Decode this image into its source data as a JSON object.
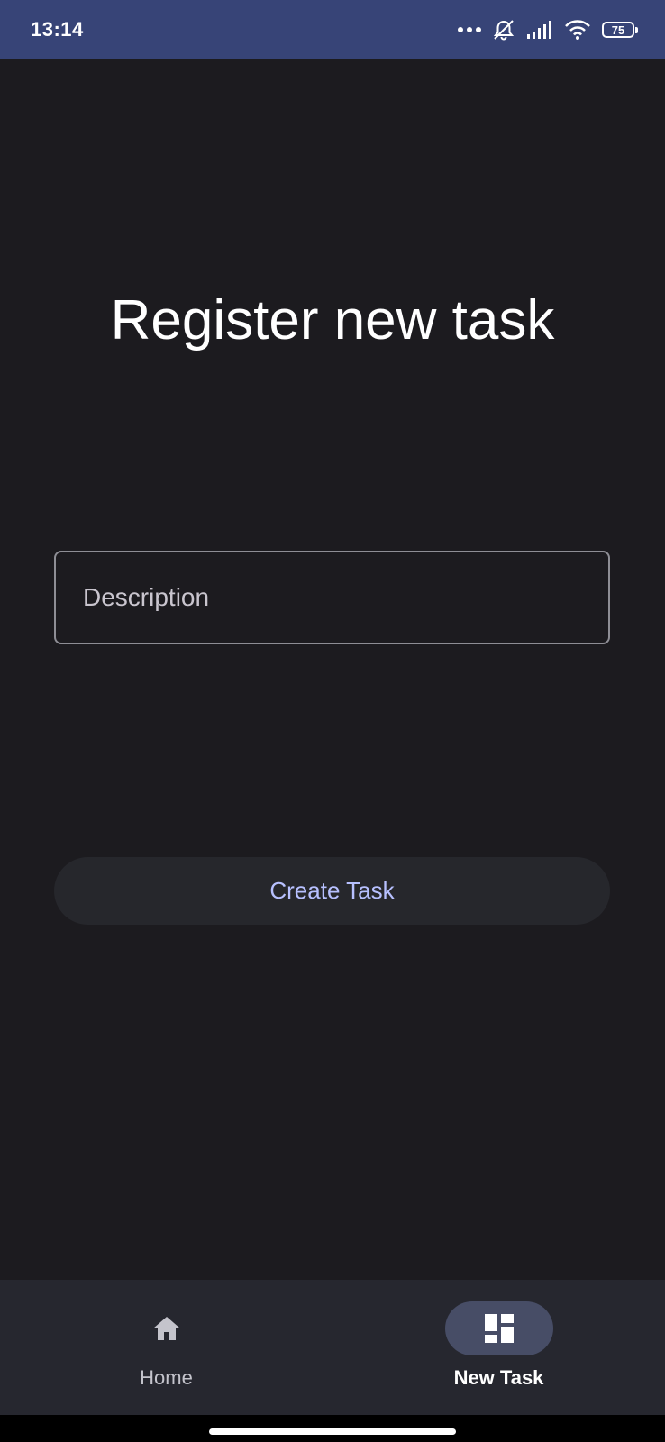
{
  "status_bar": {
    "time": "13:14",
    "battery": "75",
    "icons": [
      "more-dots-icon",
      "bell-off-icon",
      "signal-icon",
      "wifi-icon",
      "battery-icon"
    ]
  },
  "main": {
    "title": "Register new task",
    "description_field": {
      "placeholder": "Description",
      "value": ""
    },
    "create_button_label": "Create Task"
  },
  "bottom_nav": {
    "items": [
      {
        "label": "Home",
        "icon": "home-icon",
        "active": false
      },
      {
        "label": "New Task",
        "icon": "dashboard-icon",
        "active": true
      }
    ]
  },
  "colors": {
    "status_bar_bg": "#374477",
    "background": "#1c1b1f",
    "button_text": "#b7c0ff",
    "nav_bg": "#26272f",
    "nav_active_indicator": "#474d66"
  }
}
